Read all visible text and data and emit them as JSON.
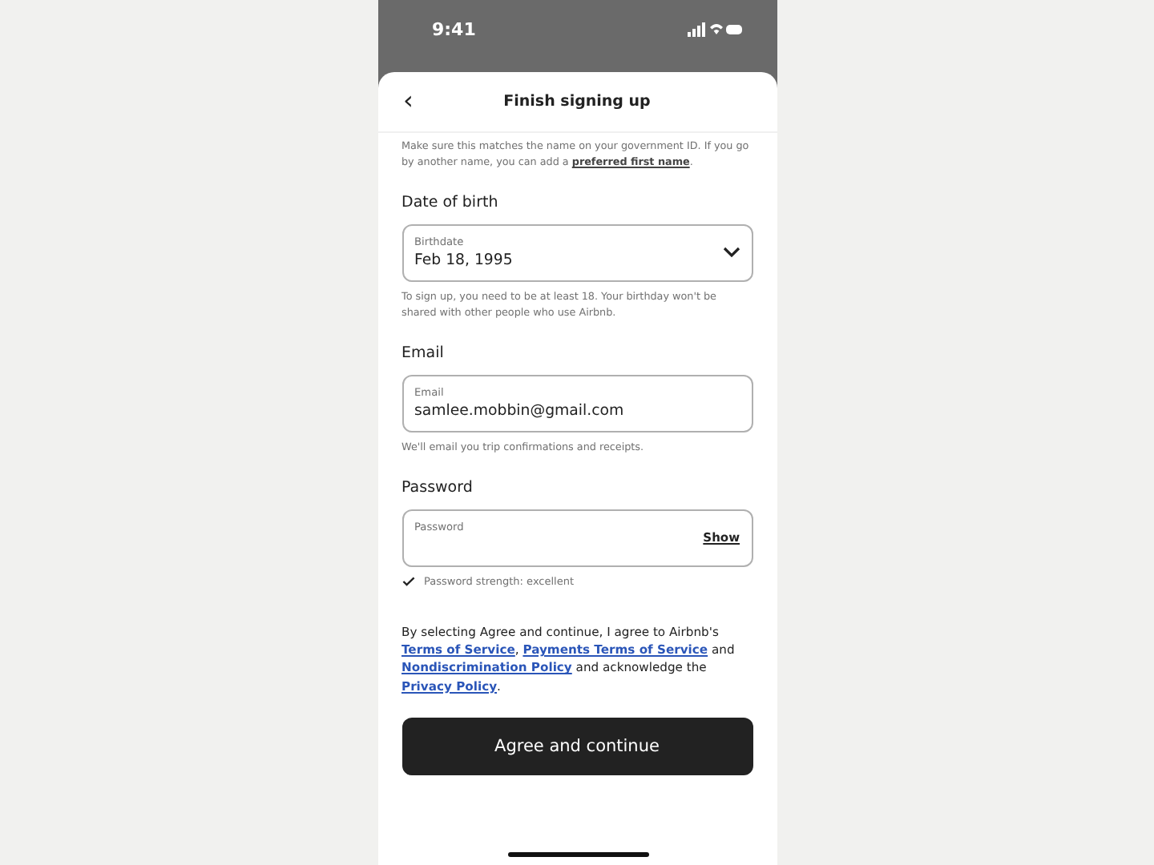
{
  "status_bar": {
    "time": "9:41"
  },
  "header": {
    "back": "‹",
    "title": "Finish signing up"
  },
  "name_note": [
    {
      "kind": "text",
      "text": "Make sure this matches the name on your government ID. If you go by another name, you can add a "
    },
    {
      "kind": "link",
      "text": "preferred first name"
    },
    {
      "kind": "text",
      "text": "."
    }
  ],
  "sections": [
    {
      "heading": "Date of birth",
      "kind": "dropdown",
      "label": "Birthdate",
      "value": "Feb 18, 1995",
      "hint": "To sign up, you need to be at least 18. Your birthday won't be shared with other people who use Airbnb."
    },
    {
      "heading": "Email",
      "kind": "text",
      "label": "Email",
      "value": "samlee.mobbin@gmail.com",
      "hint": "We'll email you trip confirmations and receipts."
    },
    {
      "heading": "Password",
      "kind": "password",
      "label": "Password",
      "action": "Show",
      "strength": "Password strength: excellent"
    }
  ],
  "consent": [
    {
      "kind": "text",
      "text": "By selecting Agree and continue, I agree to Airbnb's "
    },
    {
      "kind": "link",
      "text": "Terms of Service"
    },
    {
      "kind": "text",
      "text": ", "
    },
    {
      "kind": "link",
      "text": "Payments Terms of Service"
    },
    {
      "kind": "text",
      "text": " and "
    },
    {
      "kind": "link",
      "text": "Nondiscrimination Policy"
    },
    {
      "kind": "text",
      "text": " and acknowledge the "
    },
    {
      "kind": "link",
      "text": "Privacy Policy"
    },
    {
      "kind": "text",
      "text": "."
    }
  ],
  "primary_button": "Agree and continue"
}
